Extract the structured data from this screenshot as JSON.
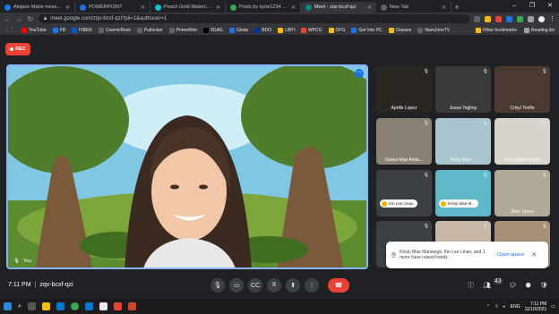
{
  "tabs": [
    {
      "title": "Alejane Marie messaged Y",
      "color": "#1877f2",
      "active": false
    },
    {
      "title": "POWERPOINT",
      "color": "#1a73e8",
      "active": false
    },
    {
      "title": "Peach Gold Watercolor Plu",
      "color": "#00c4cc",
      "active": false
    },
    {
      "title": "Posts by kyrie1234 — Stee",
      "color": "#34a853",
      "active": false
    },
    {
      "title": "Meet - zqv-bcxf-qzi",
      "color": "#00897b",
      "active": true
    },
    {
      "title": "New Tab",
      "color": "#5f6368",
      "active": false
    }
  ],
  "address": {
    "url": "meet.google.com/zqv-bcxf-qzi?pli=1&authuser=1"
  },
  "bookmarks": [
    {
      "label": "YouTube",
      "color": "#ff0000"
    },
    {
      "label": "FB",
      "color": "#1877f2"
    },
    {
      "label": "FIBER",
      "color": "#0b57d0"
    },
    {
      "label": "CosmicBook",
      "color": "#5f6368"
    },
    {
      "label": "Putlocker",
      "color": "#5f6368"
    },
    {
      "label": "PrimeWire",
      "color": "#5f6368"
    },
    {
      "label": "9GAG",
      "color": "#000000"
    },
    {
      "label": "Globe",
      "color": "#1a73e8"
    },
    {
      "label": "BDO",
      "color": "#0033a0"
    },
    {
      "label": "LBPI",
      "color": "#fbbc04"
    },
    {
      "label": "WPCG",
      "color": "#ea4335"
    },
    {
      "label": "OFG",
      "color": "#fbbc04"
    },
    {
      "label": "Get Into PC",
      "color": "#1a73e8"
    },
    {
      "label": "Classes",
      "color": "#fbbc04"
    },
    {
      "label": "NamJohnTV",
      "color": "#5f6368"
    }
  ],
  "bookmarks_right": {
    "other": "Other bookmarks",
    "reading": "Reading list"
  },
  "rec_label": "REC",
  "main_video": {
    "name": "You"
  },
  "participants": [
    {
      "name": "Aprille Lopez",
      "bg": "#2a2622"
    },
    {
      "name": "Josua Teghoy",
      "bg": "#3a3a38"
    },
    {
      "name": "Crisyl Teoflo",
      "bg": "#4a3a32"
    },
    {
      "name": "Glaisa Mae Anda...",
      "bg": "#8a8274"
    },
    {
      "name": "Ruby Mae ...",
      "bg": "#a8c4cc"
    },
    {
      "name": "Dars Javier Bakal",
      "bg": "#d8d4cc"
    },
    {
      "name": "Kin Lee Linao",
      "bg": "#3c4043",
      "raised": true
    },
    {
      "name": "Kristy Mae M...",
      "bg": "#5fb8c8",
      "raised": true
    },
    {
      "name": "Jhon Taneo",
      "bg": "#b0a898"
    },
    {
      "name": "Ar...",
      "bg": "#3c4043"
    },
    {
      "name": "",
      "bg": "#c8b8a8"
    },
    {
      "name": "",
      "bg": "#a89078"
    }
  ],
  "toast": {
    "message": "Kristy Mae Manlangit, Kin Lee Linao, and 1 more have raised hands",
    "action": "Open queue"
  },
  "meeting": {
    "time": "7:11 PM",
    "separator": "|",
    "code": "zqv-bcxf-qzi"
  },
  "people_count": "43",
  "taskbar": {
    "lang": "ENG",
    "time": "7:11 PM",
    "date": "11/10/2021"
  }
}
